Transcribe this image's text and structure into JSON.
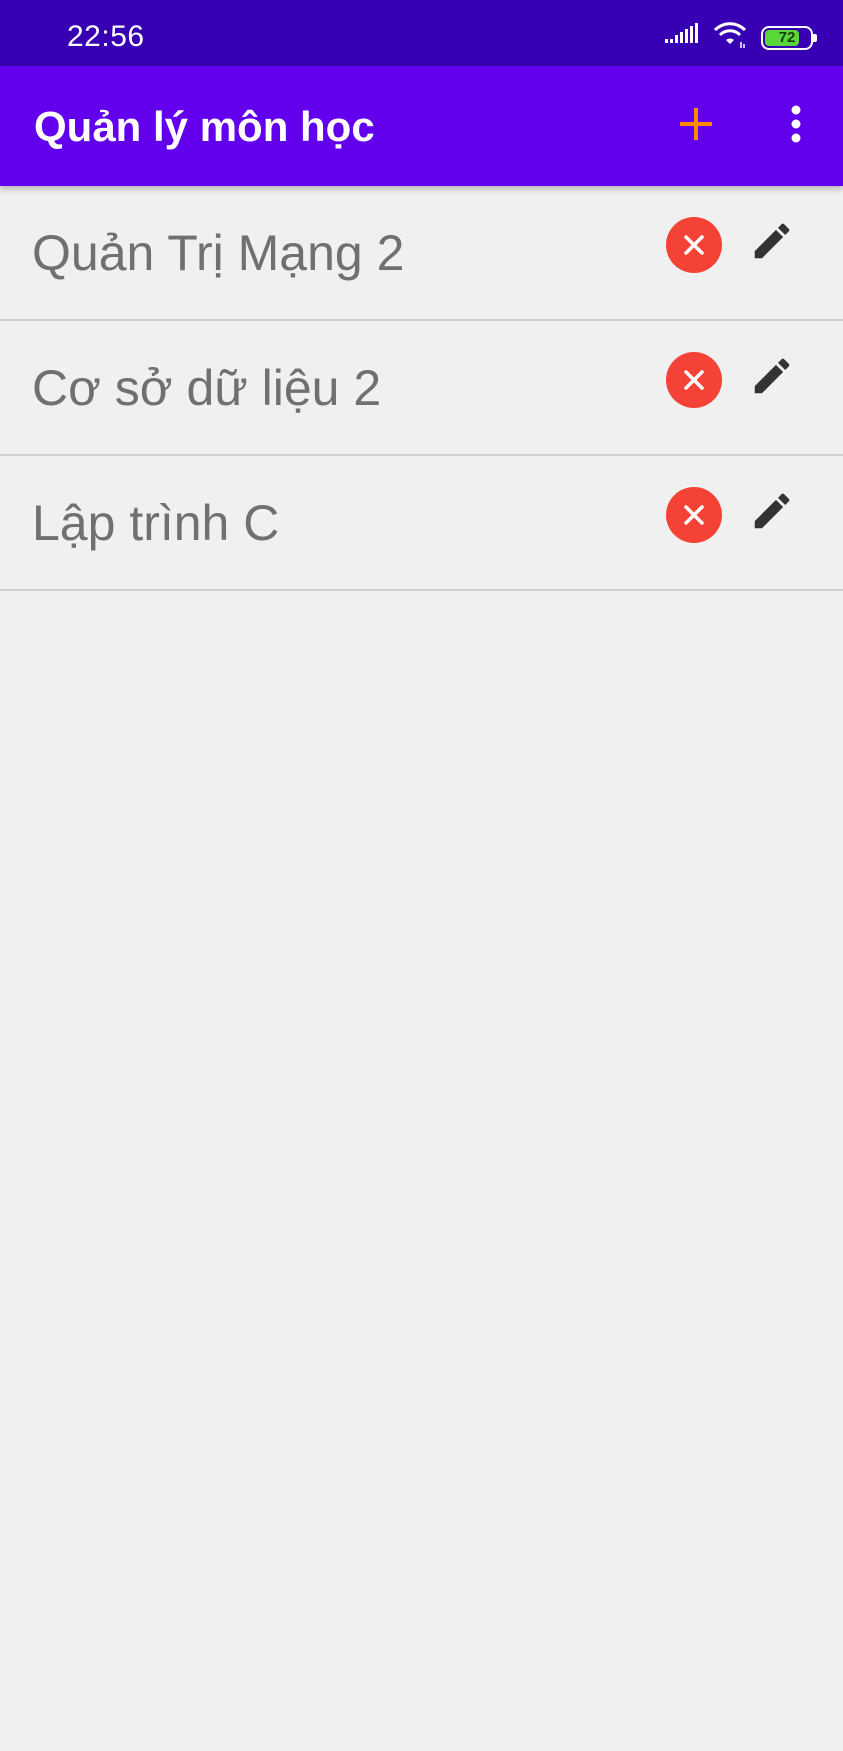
{
  "status_bar": {
    "time": "22:56",
    "battery_level": "72",
    "icons": [
      "signal-icon",
      "wifi-icon",
      "battery-icon"
    ]
  },
  "app_bar": {
    "title": "Quản lý môn học",
    "actions": [
      "add-icon",
      "more-vert-icon"
    ]
  },
  "subjects": [
    {
      "name": "Quản Trị Mạng 2"
    },
    {
      "name": "Cơ sở dữ liệu 2"
    },
    {
      "name": "Lập trình C"
    }
  ],
  "colors": {
    "status_bar": "#3700b3",
    "app_bar": "#6200ee",
    "add_icon": "#ff8a00",
    "delete_button": "#f44336",
    "edit_icon": "#333333",
    "subject_text": "#707070",
    "background": "#f0f0f0",
    "battery_fill": "#58d63a"
  }
}
